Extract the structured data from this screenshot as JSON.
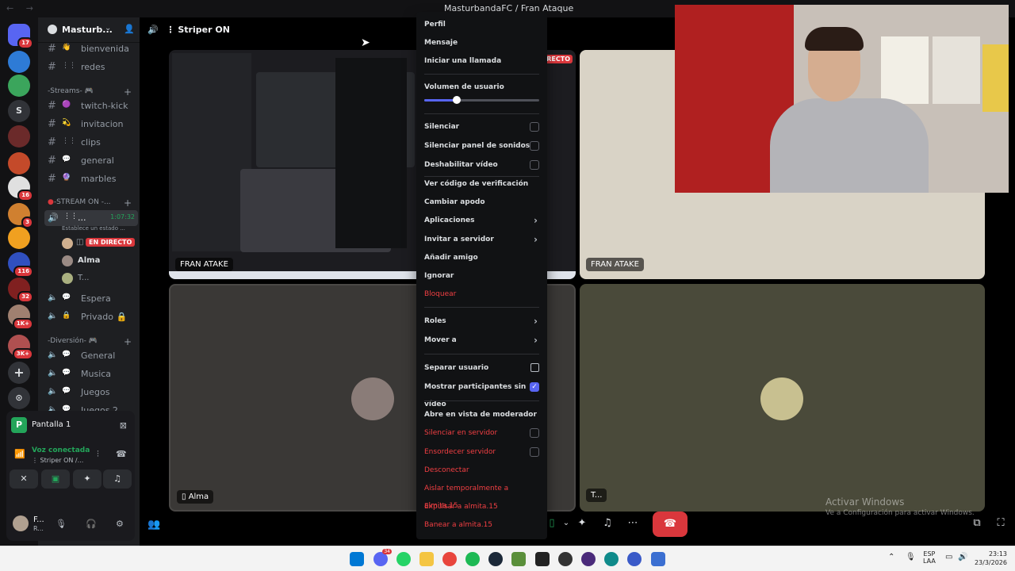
{
  "window": {
    "title": "MasturbandaFC / Fran Ataque",
    "nav": "← →"
  },
  "server": {
    "name": "Masturb...",
    "dropdown": "⌄",
    "invite_icon": "add-member-icon"
  },
  "channels": {
    "text": [
      {
        "emoji": "👋",
        "label": "bienvenida"
      },
      {
        "emoji": "⋮⋮",
        "label": "redes"
      }
    ],
    "streams_category": "-Streams-",
    "streams": [
      {
        "emoji": "🟣",
        "label": "twitch-kick"
      },
      {
        "emoji": "💫",
        "label": "invitacion"
      },
      {
        "emoji": "⋮⋮",
        "label": "clips"
      },
      {
        "emoji": "💬",
        "label": "general"
      },
      {
        "emoji": "🔮",
        "label": "marbles"
      }
    ],
    "stream_on_category": "-STREAM ON -...",
    "active_voice": {
      "label": "...",
      "timer": "1:07:32",
      "status": "Establece un estado ..."
    },
    "voice_users": [
      {
        "name": "",
        "badge": "EN DIRECTO"
      },
      {
        "name": "Alma",
        "badge": ""
      },
      {
        "name": "T...",
        "badge": ""
      }
    ],
    "voice_channels": [
      {
        "label": "Espera"
      },
      {
        "label": "Privado 🔒"
      }
    ],
    "diversion_category": "-Diversión-",
    "diversion": [
      {
        "label": "General"
      },
      {
        "label": "Musica"
      },
      {
        "label": "Juegos"
      },
      {
        "label": "Juegos 2"
      }
    ]
  },
  "guild_badges": {
    "g1": "17",
    "g7": "16",
    "g8": "3",
    "g10": "116",
    "g11": "32",
    "g12": "1K+",
    "g13": "3K+"
  },
  "guild_letter": "S",
  "voice_panel": {
    "screen_label": "Pantalla 1",
    "screen_letter": "P",
    "connected": "Voz conectada",
    "channel": "⋮ Striper ON /...",
    "user_name": "F...",
    "user_status": "R..."
  },
  "main": {
    "header": "⋮ Striper ON",
    "tiles": {
      "stream_tag": "FRAN ATAKE",
      "right_tag": "FRAN ATAKE",
      "alma_tag": "Alma",
      "t_tag": "T...",
      "live_corner": "RECTO"
    }
  },
  "context_menu": {
    "group1": [
      "Perfil",
      "Mensaje",
      "Iniciar una llamada"
    ],
    "volume_label": "Volumen de usuario",
    "volume_level": 0.28,
    "checks": [
      {
        "label": "Silenciar",
        "checked": false
      },
      {
        "label": "Silenciar panel de sonidos",
        "checked": false
      },
      {
        "label": "Deshabilitar vídeo",
        "checked": false
      }
    ],
    "group3": [
      {
        "label": "Ver código de verificación"
      },
      {
        "label": "Cambiar apodo"
      },
      {
        "label": "Aplicaciones",
        "submenu": true
      },
      {
        "label": "Invitar a servidor",
        "submenu": true
      },
      {
        "label": "Añadir amigo"
      },
      {
        "label": "Ignorar"
      },
      {
        "label": "Bloquear",
        "danger": true
      }
    ],
    "group4": [
      {
        "label": "Roles",
        "submenu": true
      },
      {
        "label": "Mover a",
        "submenu": true
      }
    ],
    "separate": "Separar usuario",
    "show_no_video": "Mostrar participantes sin vídeo",
    "moderator": "Abre en vista de moderador",
    "mod_checks": [
      "Silenciar en servidor",
      "Ensordecer servidor"
    ],
    "danger": [
      "Desconectar",
      "Aislar temporalmente a almita.15",
      "Expulsar a almita.15",
      "Banear a almita.15"
    ]
  },
  "watermark": {
    "title": "Activar Windows",
    "subtitle": "Ve a Configuración para activar Windows."
  },
  "taskbar": {
    "lang1": "ESP",
    "lang2": "LAA",
    "time": "23:13",
    "date": "23/3/2026",
    "discord_badge": "34"
  },
  "colors": {
    "accent": "#5865f2",
    "danger": "#da373c",
    "online": "#23a55a"
  }
}
